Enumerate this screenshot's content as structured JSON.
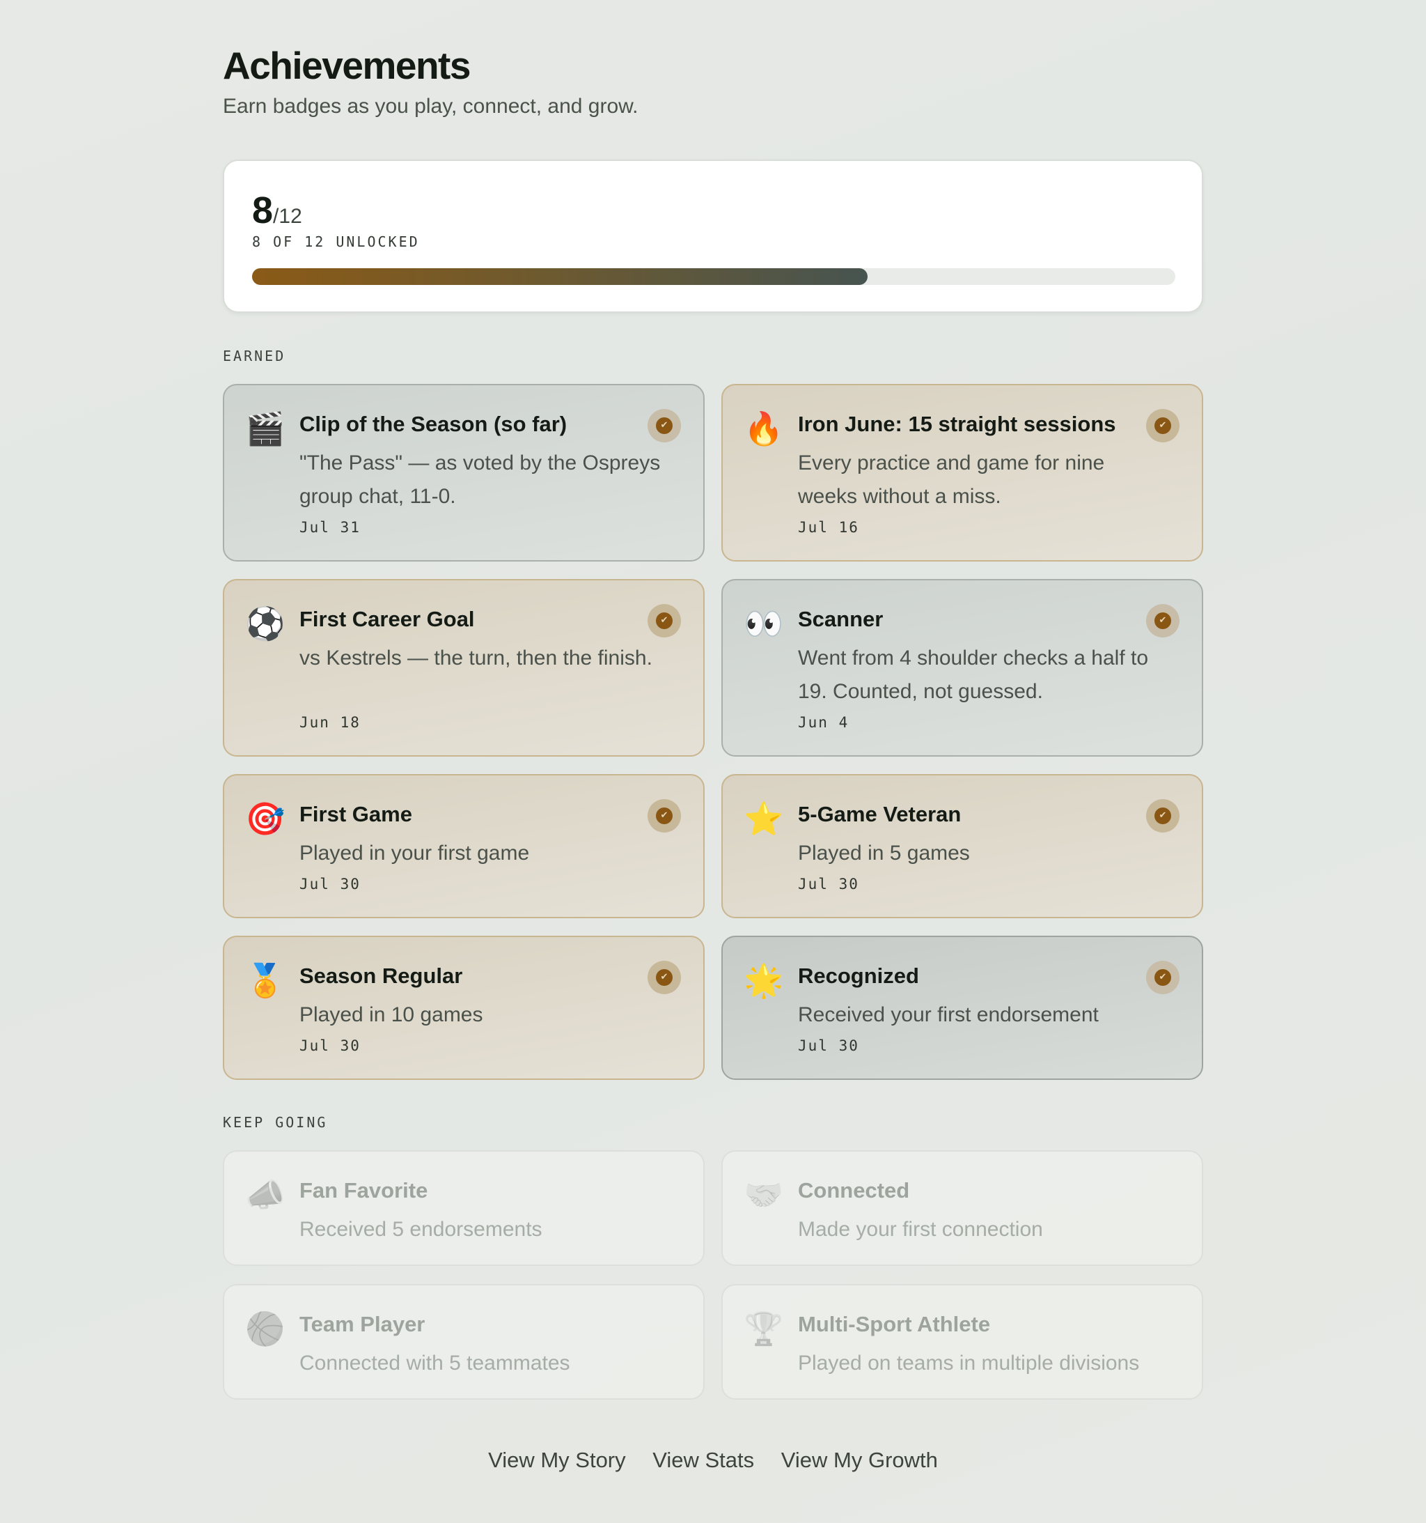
{
  "header": {
    "title": "Achievements",
    "subtitle": "Earn badges as you play, connect, and grow."
  },
  "progress": {
    "unlocked": "8",
    "total_suffix": "/12",
    "label": "8 OF 12 UNLOCKED",
    "fraction": 0.6667
  },
  "sections": {
    "earned_label": "EARNED",
    "keep_going_label": "KEEP GOING"
  },
  "earned": [
    {
      "icon": "🎬",
      "icon_name": "clapperboard-icon",
      "name": "Clip of the Season (so far)",
      "desc": "\"The Pass\" — as voted by the Ospreys group chat, 11-0.",
      "date": "Jul 31"
    },
    {
      "icon": "🔥",
      "icon_name": "fire-icon",
      "name": "Iron June: 15 straight sessions",
      "desc": "Every practice and game for nine weeks without a miss.",
      "date": "Jul 16"
    },
    {
      "icon": "⚽",
      "icon_name": "soccer-ball-icon",
      "name": "First Career Goal",
      "desc": "vs Kestrels — the turn, then the finish.",
      "date": "Jun 18"
    },
    {
      "icon": "👀",
      "icon_name": "eyes-icon",
      "name": "Scanner",
      "desc": "Went from 4 shoulder checks a half to 19. Counted, not guessed.",
      "date": "Jun 4"
    },
    {
      "icon": "🎯",
      "icon_name": "target-icon",
      "name": "First Game",
      "desc": "Played in your first game",
      "date": "Jul 30"
    },
    {
      "icon": "⭐",
      "icon_name": "star-icon",
      "name": "5-Game Veteran",
      "desc": "Played in 5 games",
      "date": "Jul 30"
    },
    {
      "icon": "🏅",
      "icon_name": "medal-icon",
      "name": "Season Regular",
      "desc": "Played in 10 games",
      "date": "Jul 30"
    },
    {
      "icon": "🌟",
      "icon_name": "glowing-star-icon",
      "name": "Recognized",
      "desc": "Received your first endorsement",
      "date": "Jul 30"
    }
  ],
  "locked": [
    {
      "icon": "📣",
      "icon_name": "megaphone-icon",
      "name": "Fan Favorite",
      "desc": "Received 5 endorsements"
    },
    {
      "icon": "🤝",
      "icon_name": "handshake-icon",
      "name": "Connected",
      "desc": "Made your first connection"
    },
    {
      "icon": "🏀",
      "icon_name": "basketball-icon",
      "name": "Team Player",
      "desc": "Connected with 5 teammates"
    },
    {
      "icon": "🏆",
      "icon_name": "trophy-icon",
      "name": "Multi-Sport Athlete",
      "desc": "Played on teams in multiple divisions"
    }
  ],
  "check_glyph": "✔",
  "footer": {
    "links": [
      "View My Story",
      "View Stats",
      "View My Growth"
    ]
  }
}
